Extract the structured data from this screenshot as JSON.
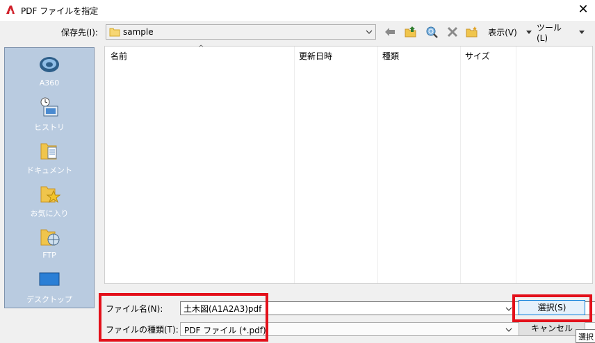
{
  "window": {
    "title": "PDF ファイルを指定",
    "close_glyph": "✕"
  },
  "toolbar": {
    "save_in_label": "保存先(I):",
    "save_in_value": "sample",
    "views_label": "表示(V)",
    "tools_label": "ツール(L)"
  },
  "places": [
    {
      "label": "A360",
      "icon": "a360-cloud-icon"
    },
    {
      "label": "ヒストリ",
      "icon": "history-icon"
    },
    {
      "label": "ドキュメント",
      "icon": "documents-icon"
    },
    {
      "label": "お気に入り",
      "icon": "favorites-icon"
    },
    {
      "label": "FTP",
      "icon": "ftp-icon"
    },
    {
      "label": "デスクトップ",
      "icon": "desktop-icon"
    }
  ],
  "file_list": {
    "columns": [
      "名前",
      "更新日時",
      "種類",
      "サイズ"
    ],
    "sort_indicator": "^",
    "rows": []
  },
  "bottom": {
    "file_name_label": "ファイル名(N):",
    "file_name_value": "土木図(A1A2A3)pdf",
    "file_type_label": "ファイルの種類(T):",
    "file_type_value": "PDF ファイル (*.pdf)",
    "select_label": "選択(S)",
    "cancel_label": "キャンセル",
    "tooltip_label": "選択"
  },
  "colors": {
    "highlight": "#e3101a",
    "places_bg": "#b9cbe0",
    "accent": "#0078d7"
  }
}
